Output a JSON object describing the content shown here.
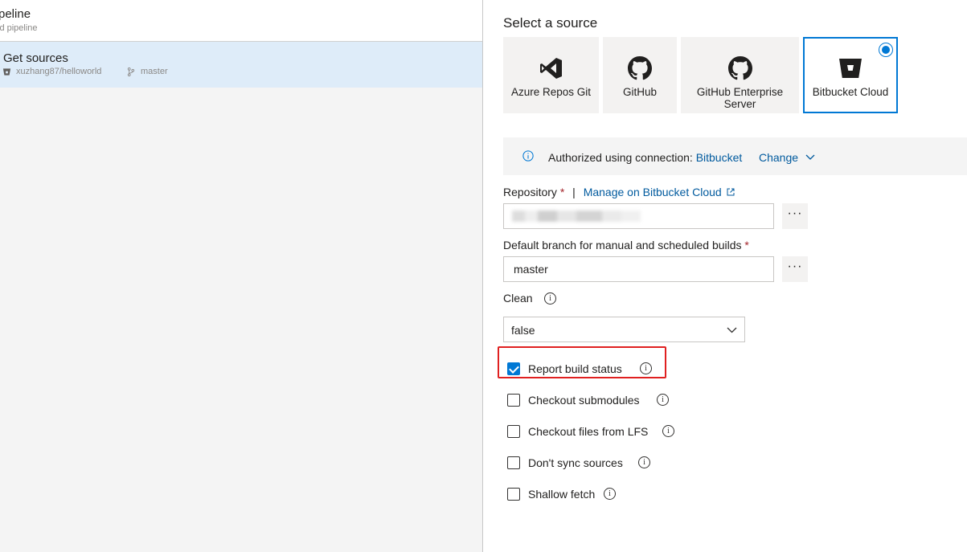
{
  "left": {
    "pipeline_title": "peline",
    "pipeline_subtitle": "ld pipeline",
    "get_sources": {
      "title": "Get sources",
      "repo": "xuzhang87/helloworld",
      "branch": "master"
    }
  },
  "right": {
    "select_source_title": "Select a source",
    "sources": [
      {
        "label": "Azure Repos Git",
        "icon": "azure-repos-icon",
        "selected": false
      },
      {
        "label": "GitHub",
        "icon": "github-icon",
        "selected": false
      },
      {
        "label": "GitHub Enterprise Server",
        "icon": "github-icon",
        "selected": false
      },
      {
        "label": "Bitbucket Cloud",
        "icon": "bitbucket-icon",
        "selected": true
      }
    ],
    "auth": {
      "text": "Authorized using connection:",
      "connection": "Bitbucket",
      "change": "Change"
    },
    "repository": {
      "label": "Repository",
      "required": "*",
      "separator": "|",
      "manage_link": "Manage on Bitbucket Cloud",
      "value": ""
    },
    "branch": {
      "label": "Default branch for manual and scheduled builds",
      "required": "*",
      "value": "master"
    },
    "clean": {
      "label": "Clean",
      "value": "false"
    },
    "options": [
      {
        "label": "Report build status",
        "checked": true
      },
      {
        "label": "Checkout submodules",
        "checked": false
      },
      {
        "label": "Checkout files from LFS",
        "checked": false
      },
      {
        "label": "Don't sync sources",
        "checked": false
      },
      {
        "label": "Shallow fetch",
        "checked": false
      }
    ],
    "ellipsis": "···",
    "info_glyph": "i"
  },
  "colors": {
    "accent": "#0078d4",
    "link": "#005a9e",
    "selected_row": "#deecf9",
    "highlight": "#e02020",
    "required": "#a4262c"
  }
}
